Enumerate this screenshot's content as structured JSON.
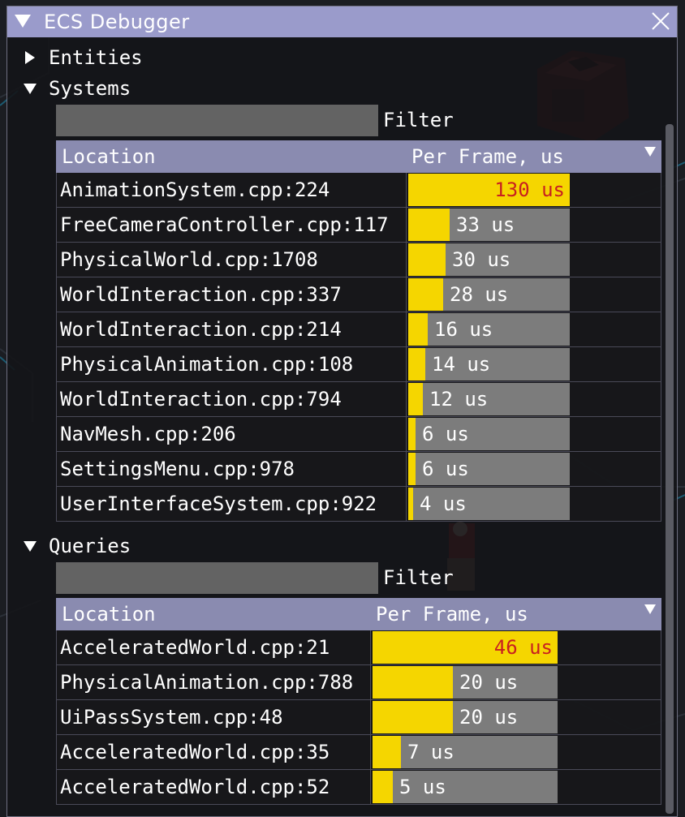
{
  "window": {
    "title": "ECS Debugger"
  },
  "entities": {
    "label": "Entities"
  },
  "systems": {
    "label": "Systems",
    "filter": {
      "label": "Filter",
      "value": ""
    },
    "columns": [
      "Location",
      "Per Frame, us"
    ],
    "max_us": 130,
    "rows": [
      {
        "location": "AnimationSystem.cpp:224",
        "value": 130,
        "text": "130 us"
      },
      {
        "location": "FreeCameraController.cpp:117",
        "value": 33,
        "text": "33 us"
      },
      {
        "location": "PhysicalWorld.cpp:1708",
        "value": 30,
        "text": "30 us"
      },
      {
        "location": "WorldInteraction.cpp:337",
        "value": 28,
        "text": "28 us"
      },
      {
        "location": "WorldInteraction.cpp:214",
        "value": 16,
        "text": "16 us"
      },
      {
        "location": "PhysicalAnimation.cpp:108",
        "value": 14,
        "text": "14 us"
      },
      {
        "location": "WorldInteraction.cpp:794",
        "value": 12,
        "text": "12 us"
      },
      {
        "location": "NavMesh.cpp:206",
        "value": 6,
        "text": "6 us"
      },
      {
        "location": "SettingsMenu.cpp:978",
        "value": 6,
        "text": "6 us"
      },
      {
        "location": "UserInterfaceSystem.cpp:922",
        "value": 4,
        "text": "4 us"
      }
    ]
  },
  "queries": {
    "label": "Queries",
    "filter": {
      "label": "Filter",
      "value": ""
    },
    "columns": [
      "Location",
      "Per Frame, us"
    ],
    "max_us": 46,
    "rows": [
      {
        "location": "AcceleratedWorld.cpp:21",
        "value": 46,
        "text": "46 us"
      },
      {
        "location": "PhysicalAnimation.cpp:788",
        "value": 20,
        "text": "20 us"
      },
      {
        "location": "UiPassSystem.cpp:48",
        "value": 20,
        "text": "20 us"
      },
      {
        "location": "AcceleratedWorld.cpp:35",
        "value": 7,
        "text": "7 us"
      },
      {
        "location": "AcceleratedWorld.cpp:52",
        "value": 5,
        "text": "5 us"
      }
    ]
  },
  "colors": {
    "titlebar": "#9a9bcb",
    "header": "#8a8bb0",
    "bar_fill": "#f5d600",
    "bar_track": "#7c7c7c",
    "max_text": "#c82020"
  }
}
